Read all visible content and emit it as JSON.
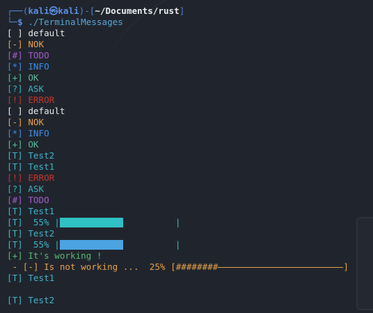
{
  "prompt": {
    "user": "kali",
    "host": "kali",
    "path": "~/Documents/rust",
    "command": "./TerminalMessages"
  },
  "lines": [
    {
      "tag": "[ ]",
      "text": "default",
      "type": "default"
    },
    {
      "tag": "[-]",
      "text": "NOK",
      "type": "nok"
    },
    {
      "tag": "[#]",
      "text": "TODO",
      "type": "todo"
    },
    {
      "tag": "[*]",
      "text": "INFO",
      "type": "info"
    },
    {
      "tag": "[+]",
      "text": "OK",
      "type": "ok"
    },
    {
      "tag": "[?]",
      "text": "ASK",
      "type": "ask"
    },
    {
      "tag": "[!]",
      "text": "ERROR",
      "type": "error"
    },
    {
      "tag": "[ ]",
      "text": "default",
      "type": "default"
    },
    {
      "tag": "[-]",
      "text": "NOK",
      "type": "nok"
    },
    {
      "tag": "[*]",
      "text": "INFO",
      "type": "info"
    },
    {
      "tag": "[+]",
      "text": "OK",
      "type": "ok"
    },
    {
      "tag": "[T]",
      "text": "Test2",
      "type": "test"
    },
    {
      "tag": "[T]",
      "text": "Test1",
      "type": "test"
    },
    {
      "tag": "[!]",
      "text": "ERROR",
      "type": "error"
    },
    {
      "tag": "[?]",
      "text": "ASK",
      "type": "ask"
    },
    {
      "tag": "[#]",
      "text": "TODO",
      "type": "todo"
    },
    {
      "tag": "[T]",
      "text": "Test1",
      "type": "test"
    },
    {
      "tag": "[T]",
      "pct": "55%",
      "progress": 0.55,
      "type": "progress",
      "fill": "cyan"
    },
    {
      "tag": "[T]",
      "text": "Test2",
      "type": "test"
    },
    {
      "tag": "[T]",
      "pct": "55%",
      "progress": 0.55,
      "type": "progress",
      "fill": "blue"
    },
    {
      "tag": "[+]",
      "text": "It's working !",
      "type": "working"
    },
    {
      "lead": " - ",
      "tag": "[-]",
      "text": "Is not working",
      "dots": "...",
      "pct": "25%",
      "progress": 0.25,
      "hashes": "########",
      "type": "ascii-progress"
    },
    {
      "tag": "[T]",
      "text": "Test1",
      "type": "test"
    },
    {
      "type": "blank"
    },
    {
      "tag": "[T]",
      "text": "Test2",
      "type": "test"
    }
  ],
  "colors": {
    "background": "#20252d",
    "default": "#e6e8eb",
    "nok": "#e7a14a",
    "todo": "#a45cc9",
    "info": "#3d8de3",
    "ok": "#56ba9a",
    "ask": "#3bb0bb",
    "error": "#c2352d",
    "test": "#3fb4c6",
    "progress_cyan": "#2fc1c3",
    "progress_blue": "#4ba3e0"
  }
}
